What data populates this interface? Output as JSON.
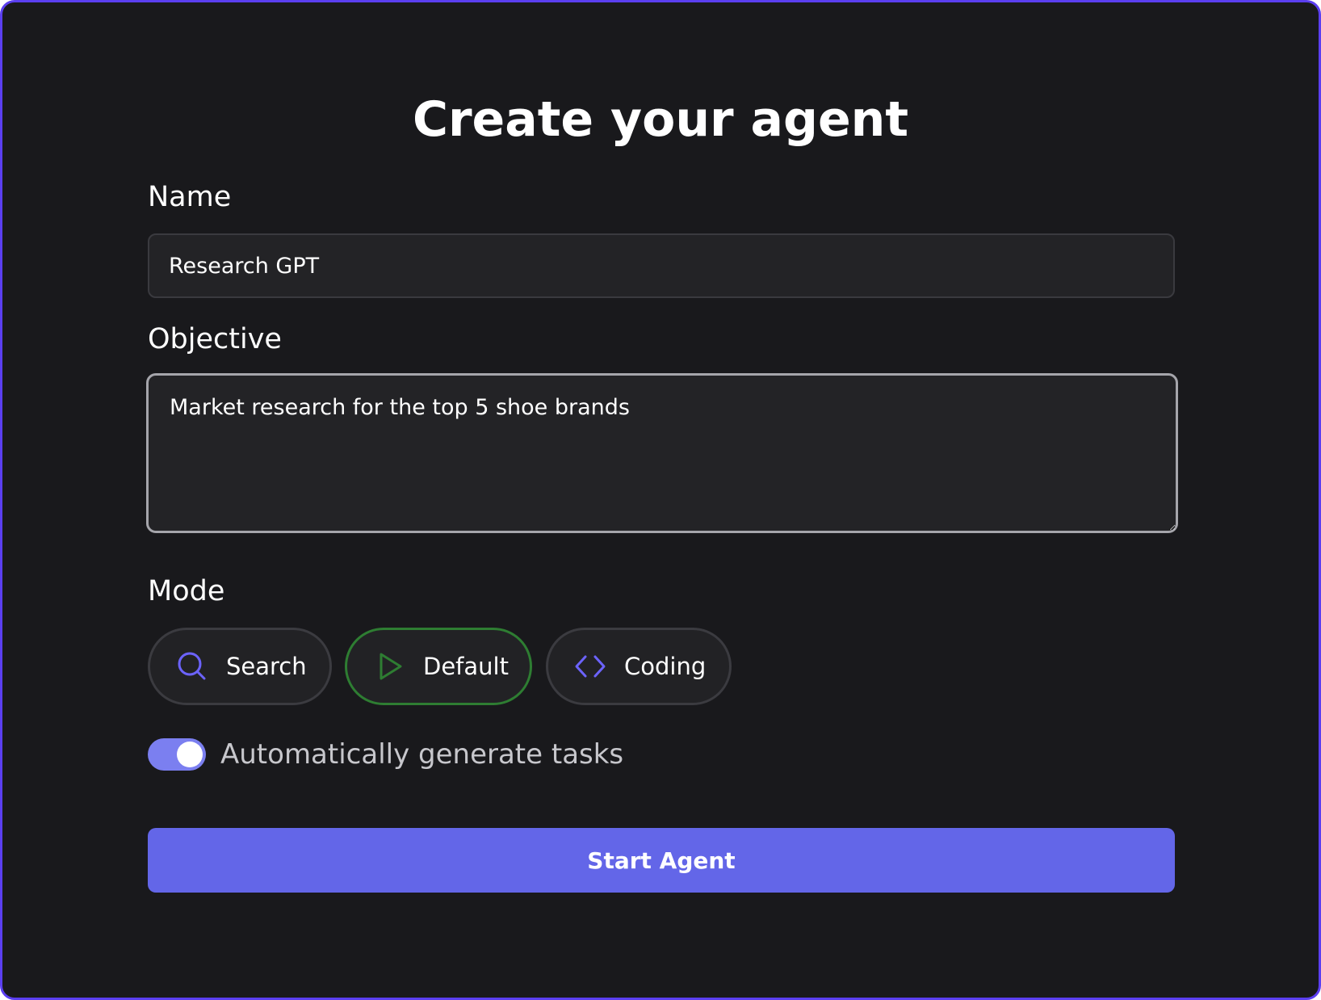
{
  "page": {
    "title": "Create your agent"
  },
  "form": {
    "name": {
      "label": "Name",
      "value": "Research GPT"
    },
    "objective": {
      "label": "Objective",
      "value": "Market research for the top 5 shoe brands"
    },
    "mode": {
      "label": "Mode",
      "selected": "Default",
      "options": [
        {
          "label": "Search",
          "icon": "search-icon"
        },
        {
          "label": "Default",
          "icon": "play-icon"
        },
        {
          "label": "Coding",
          "icon": "code-icon"
        }
      ]
    },
    "auto_tasks": {
      "label": "Automatically generate tasks",
      "enabled": true
    },
    "submit": {
      "label": "Start Agent"
    }
  },
  "colors": {
    "background": "#19191c",
    "frame_border": "#5b3ff0",
    "accent": "#6366e8",
    "selected_mode_border": "#2e7d32",
    "toggle_on": "#7b7ff0"
  }
}
